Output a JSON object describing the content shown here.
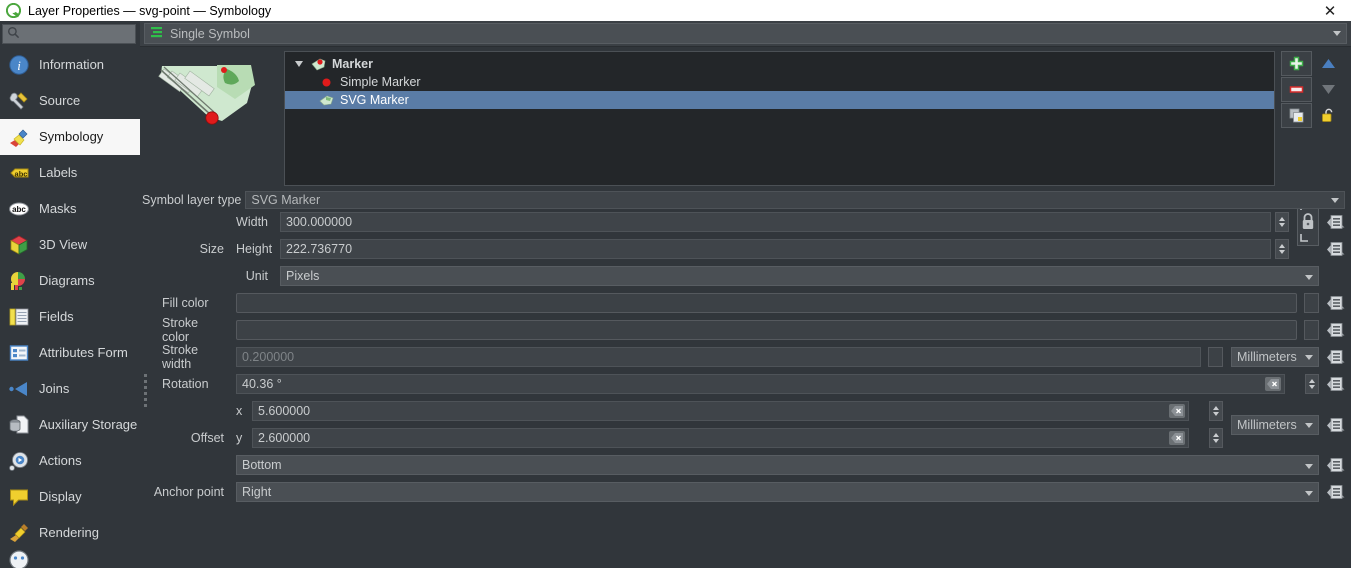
{
  "window": {
    "title": "Layer Properties — svg-point — Symbology",
    "close_label": "✕",
    "app_icon": "qgis-logo-icon"
  },
  "sidebar": {
    "search": {
      "placeholder": "",
      "value": "",
      "icon": "search-icon"
    },
    "items": [
      {
        "label": "Information",
        "icon": "info-icon",
        "active": false
      },
      {
        "label": "Source",
        "icon": "source-icon",
        "active": false
      },
      {
        "label": "Symbology",
        "icon": "symbology-brush-icon",
        "active": true
      },
      {
        "label": "Labels",
        "icon": "labels-abc-icon",
        "active": false
      },
      {
        "label": "Masks",
        "icon": "masks-abc-icon",
        "active": false
      },
      {
        "label": "3D View",
        "icon": "cube-3d-icon",
        "active": false
      },
      {
        "label": "Diagrams",
        "icon": "diagrams-chart-icon",
        "active": false
      },
      {
        "label": "Fields",
        "icon": "fields-table-icon",
        "active": false
      },
      {
        "label": "Attributes Form",
        "icon": "attributes-form-icon",
        "active": false
      },
      {
        "label": "Joins",
        "icon": "joins-icon",
        "active": false
      },
      {
        "label": "Auxiliary Storage",
        "icon": "database-icon",
        "active": false
      },
      {
        "label": "Actions",
        "icon": "actions-gear-icon",
        "active": false
      },
      {
        "label": "Display",
        "icon": "display-balloon-icon",
        "active": false
      },
      {
        "label": "Rendering",
        "icon": "rendering-brush-icon",
        "active": false
      }
    ]
  },
  "renderer": {
    "selected": "Single Symbol",
    "icon": "single-symbol-icon"
  },
  "symbol_tree": {
    "rows": [
      {
        "label": "Marker",
        "level": 0,
        "selected": false,
        "icon": "marker-preview-icon",
        "expanded": true
      },
      {
        "label": "Simple Marker",
        "level": 1,
        "selected": false,
        "icon": "simple-marker-dot-icon"
      },
      {
        "label": "SVG Marker",
        "level": 1,
        "selected": true,
        "icon": "svg-marker-icon"
      }
    ],
    "buttons": [
      {
        "name": "add-symbol-layer-button",
        "icon": "green-plus-icon"
      },
      {
        "name": "move-symbol-layer-up-button",
        "icon": "blue-up-arrow-icon"
      },
      {
        "name": "remove-symbol-layer-button",
        "icon": "red-minus-icon"
      },
      {
        "name": "move-symbol-layer-down-button",
        "icon": "grey-down-arrow-icon"
      },
      {
        "name": "duplicate-symbol-layer-button",
        "icon": "duplicate-icon"
      },
      {
        "name": "lock-layer-colors-button",
        "icon": "open-padlock-icon"
      }
    ]
  },
  "symbol_layer_type": {
    "label": "Symbol layer type",
    "value": "SVG Marker"
  },
  "properties": {
    "size": {
      "label": "Size",
      "width": {
        "label": "Width",
        "value": "300.000000"
      },
      "height": {
        "label": "Height",
        "value": "222.736770"
      },
      "unit": {
        "label": "Unit",
        "value": "Pixels"
      },
      "lock_icon": "closed-padlock-icon"
    },
    "fill_color": {
      "label": "Fill color",
      "value": ""
    },
    "stroke_color": {
      "label": "Stroke color",
      "value": ""
    },
    "stroke_width": {
      "label": "Stroke width",
      "value": "0.200000",
      "unit": "Millimeters",
      "disabled": true
    },
    "rotation": {
      "label": "Rotation",
      "value": "40.36 °"
    },
    "offset": {
      "label": "Offset",
      "x": {
        "label": "x",
        "value": "5.600000"
      },
      "y": {
        "label": "y",
        "value": "2.600000"
      },
      "unit": "Millimeters"
    },
    "anchor_point": {
      "label": "Anchor point",
      "horizontal": "Bottom",
      "vertical": "Right"
    },
    "data_defined_override_icon": "data-defined-override-icon",
    "clear_icon": "clear-x-icon"
  },
  "colors": {
    "accent": "#5a7ca6",
    "panel_bg": "#31363b",
    "field_bg": "#3f4449",
    "titlebar_bg": "#ffffff",
    "green": "#3fae4a",
    "red": "#d62a2a"
  }
}
